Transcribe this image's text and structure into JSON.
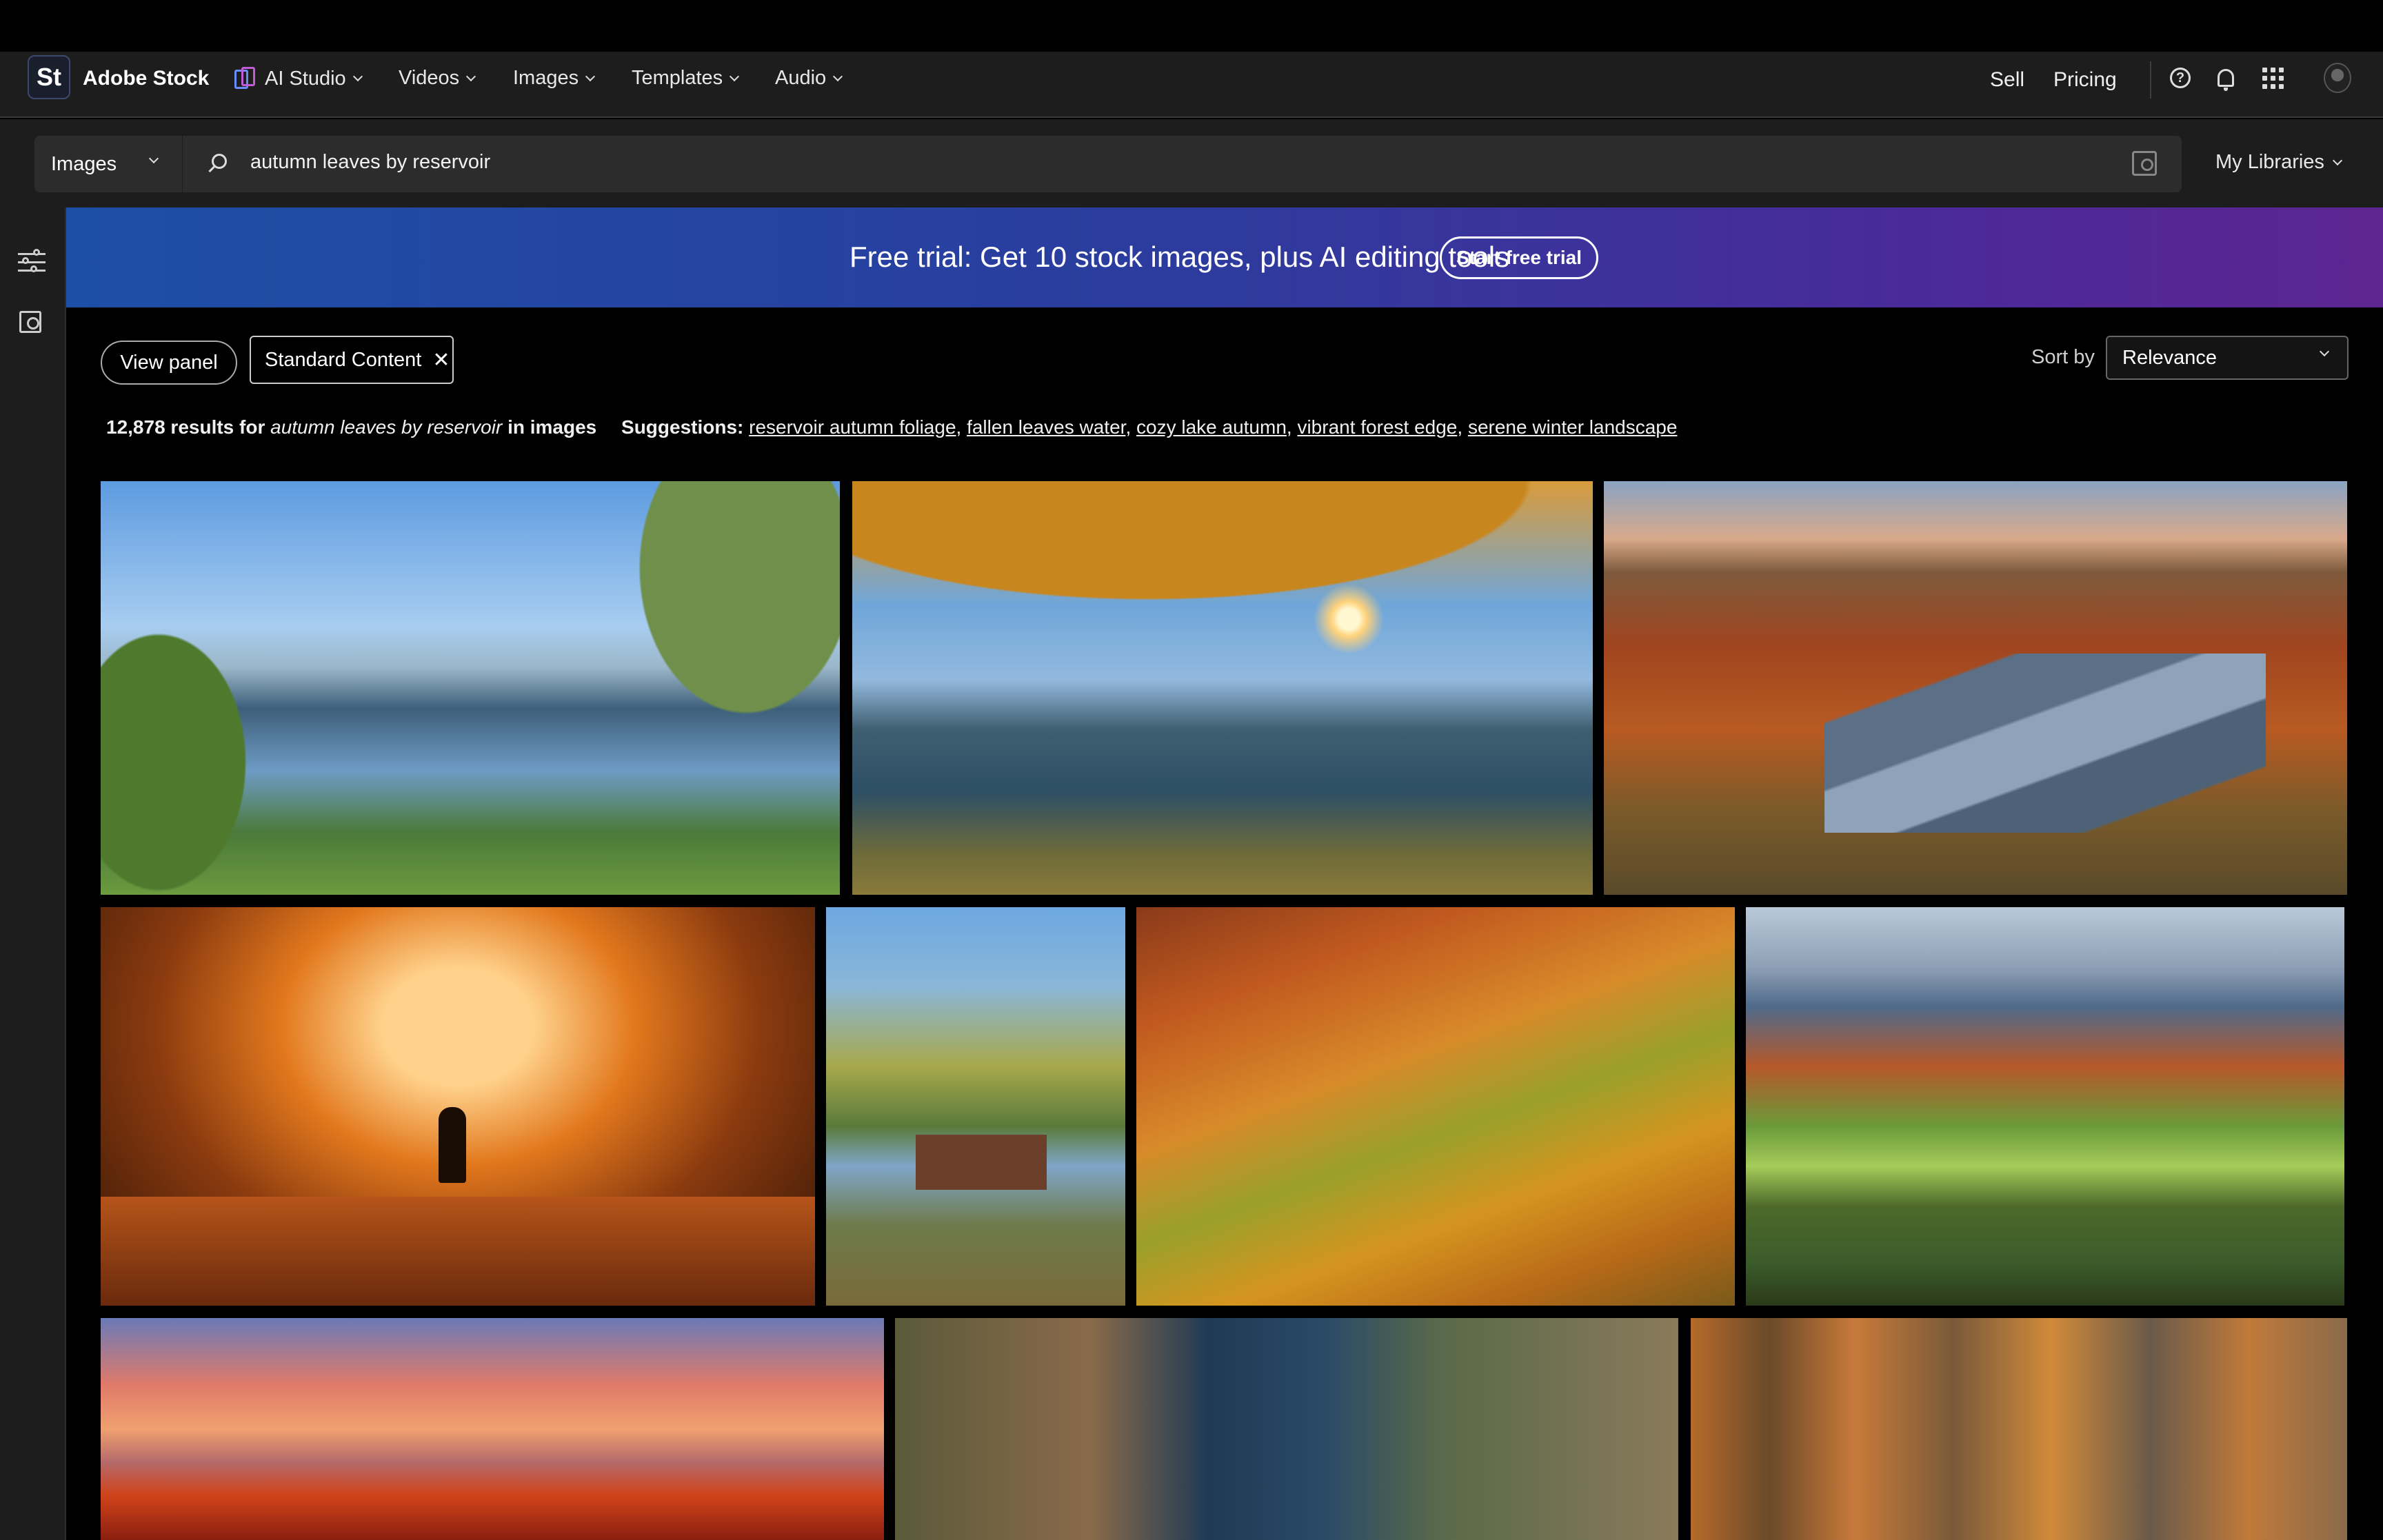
{
  "nav": {
    "logo": "St",
    "brand": "Adobe Stock",
    "items": [
      {
        "label": "AI Studio"
      },
      {
        "label": "Videos"
      },
      {
        "label": "Images"
      },
      {
        "label": "Templates"
      },
      {
        "label": "Audio"
      }
    ],
    "sell": "Sell",
    "pricing": "Pricing"
  },
  "search": {
    "type": "Images",
    "query": "autumn leaves by reservoir",
    "my_libraries": "My Libraries"
  },
  "banner": {
    "text": "Free trial: Get 10 stock images, plus AI editing tools",
    "button": "Start free trial"
  },
  "filters": {
    "view_panel": "View panel",
    "chip": "Standard Content",
    "chip_close": "✕",
    "sort_label": "Sort by",
    "sort_value": "Relevance"
  },
  "results": {
    "count": "12,878 results for",
    "query": "autumn leaves by reservoir",
    "scope": "in images",
    "suggestions_label": "Suggestions:",
    "suggestions": [
      "reservoir autumn foliage",
      "fallen leaves water",
      "cozy lake autumn",
      "vibrant forest edge",
      "serene winter landscape"
    ]
  },
  "colors": {
    "banner_start": "#1d4fa6",
    "banner_end": "#5d2590",
    "ai_studio_accent": "#c05dd6"
  }
}
